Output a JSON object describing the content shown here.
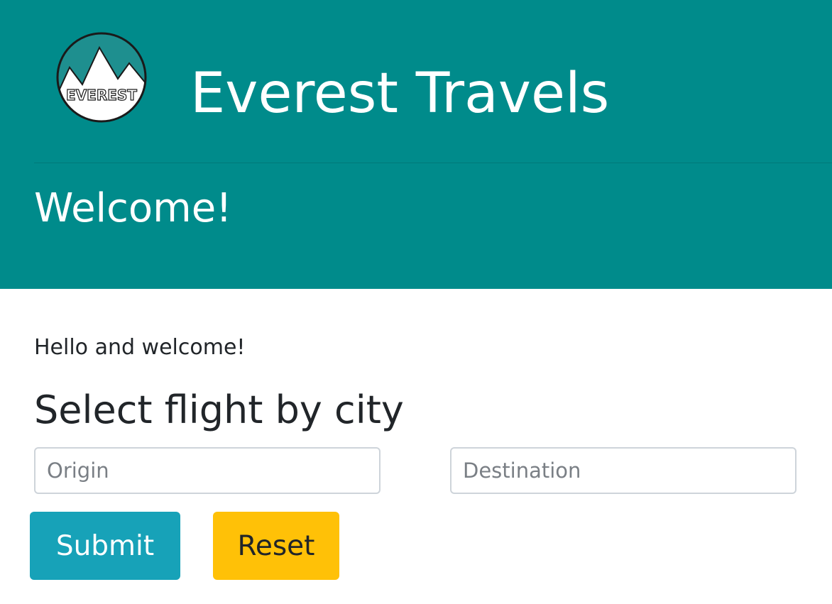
{
  "header": {
    "logo_text": "EVEREST",
    "brand": "Everest Travels",
    "welcome": "Welcome!"
  },
  "main": {
    "intro": "Hello and welcome!",
    "section_title": "Select flight by city",
    "origin": {
      "value": "",
      "placeholder": "Origin"
    },
    "destination": {
      "value": "",
      "placeholder": "Destination"
    },
    "submit_label": "Submit",
    "reset_label": "Reset"
  },
  "colors": {
    "header_bg": "#008b8b",
    "submit_bg": "#17a2b8",
    "reset_bg": "#ffc107"
  },
  "icons": {
    "logo": "mountain-logo-icon"
  }
}
